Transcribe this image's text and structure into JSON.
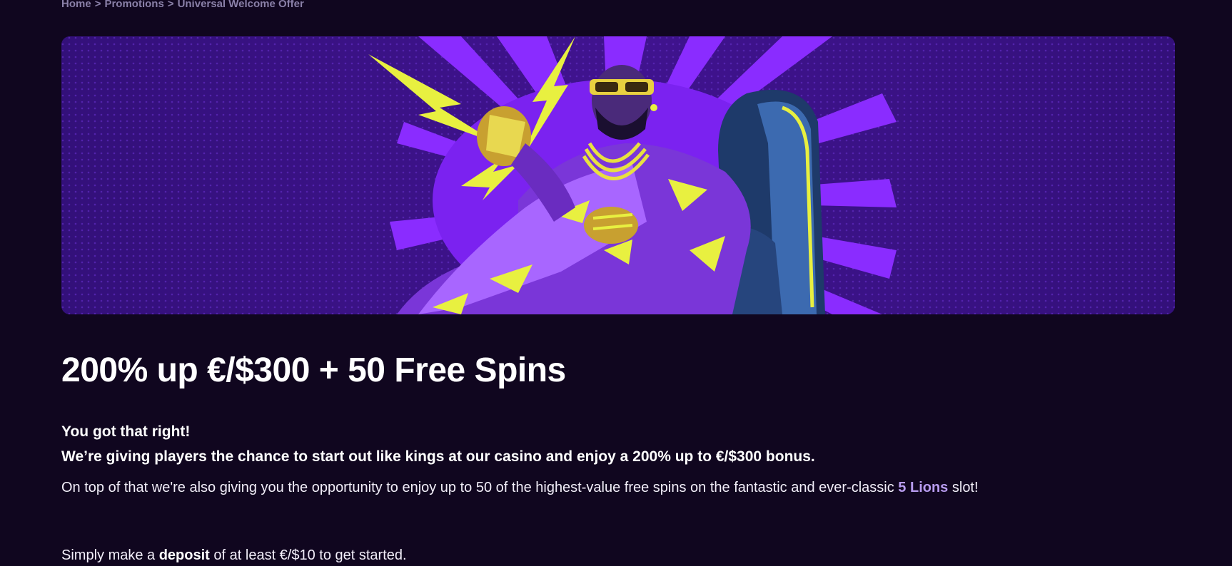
{
  "breadcrumb": {
    "items": [
      {
        "label": "Home"
      },
      {
        "label": "Promotions"
      },
      {
        "label": "Universal Welcome Offer"
      }
    ],
    "separator": ">"
  },
  "hero": {
    "image": "king-on-throne-illustration",
    "colors": {
      "background": "#3a1288",
      "accent": "#8a2cff",
      "highlight": "#e8f040"
    }
  },
  "offer": {
    "title": "200% up €/$300 + 50 Free Spins",
    "lead_line1": "You got that right!",
    "lead_line2": "We’re giving players the chance to start out like kings at our casino and enjoy a 200% up to €/$300 bonus.",
    "para1_text": "On top of that we're also giving you the opportunity to enjoy up to 50 of the highest-value free spins on the fantastic and ever-classic ",
    "para1_link": "5 Lions",
    "para1_end": " slot!",
    "para2_start": "Simply make a ",
    "para2_bold": "deposit",
    "para2_end": " of at least €/$10 to get started."
  }
}
